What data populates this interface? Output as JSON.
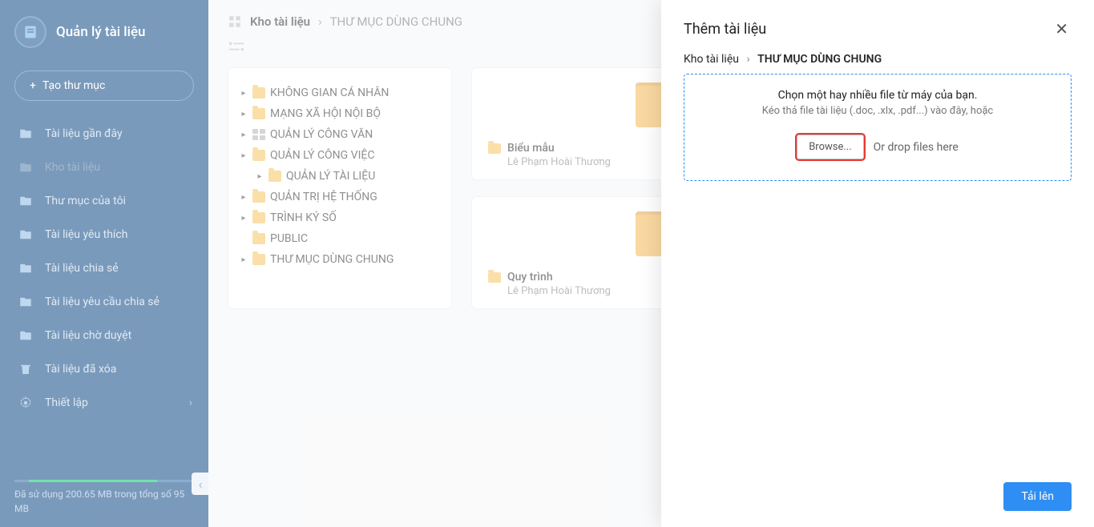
{
  "sidebar": {
    "title": "Quản lý tài liệu",
    "create_label": "Tạo thư mục",
    "nav": [
      {
        "label": "Tài liệu gần đây"
      },
      {
        "label": "Kho tài liệu"
      },
      {
        "label": "Thư mục của tôi"
      },
      {
        "label": "Tài liệu yêu thích"
      },
      {
        "label": "Tài liệu chia sẻ"
      },
      {
        "label": "Tài liệu yêu cầu chia sẻ"
      },
      {
        "label": "Tài liệu chờ duyệt"
      },
      {
        "label": "Tài liệu đã xóa"
      },
      {
        "label": "Thiết lập"
      }
    ],
    "storage": "Đã sử dụng 200.65 MB trong tổng số 95 MB"
  },
  "breadcrumb": {
    "root": "Kho tài liệu",
    "current": "THƯ MỤC DÙNG CHUNG"
  },
  "tree": [
    {
      "label": "KHÔNG GIAN CÁ NHÂN",
      "type": "folder",
      "expandable": true
    },
    {
      "label": "MẠNG XÃ HỘI NỘI BỘ",
      "type": "folder",
      "expandable": true
    },
    {
      "label": "QUẢN LÝ CÔNG VĂN",
      "type": "app",
      "expandable": true
    },
    {
      "label": "QUẢN LÝ CÔNG VIỆC",
      "type": "folder",
      "expandable": true
    },
    {
      "label": "QUẢN LÝ TÀI LIỆU",
      "type": "folder",
      "expandable": true,
      "nested": true
    },
    {
      "label": "QUẢN TRỊ HỆ THỐNG",
      "type": "folder",
      "expandable": true
    },
    {
      "label": "TRÌNH KÝ SỐ",
      "type": "folder",
      "expandable": true
    },
    {
      "label": "PUBLIC",
      "type": "folder",
      "expandable": false
    },
    {
      "label": "THƯ MỤC DÙNG CHUNG",
      "type": "folder",
      "expandable": true
    }
  ],
  "cards": [
    {
      "title": "Biểu mẫu",
      "owner": "Lê Phạm Hoài Thương"
    },
    {
      "title": "Quy trình",
      "owner": "Lê Phạm Hoài Thương"
    }
  ],
  "panel": {
    "title": "Thêm tài liệu",
    "bc_root": "Kho tài liệu",
    "bc_current": "THƯ MỤC DÙNG CHUNG",
    "dz_head": "Chọn một hay nhiều file từ máy của bạn.",
    "dz_sub": "Kéo thả file tài liệu (.doc, .xlx, .pdf...) vào đây, hoặc",
    "browse": "Browse...",
    "or_drop": "Or drop files here",
    "upload": "Tải lên"
  }
}
